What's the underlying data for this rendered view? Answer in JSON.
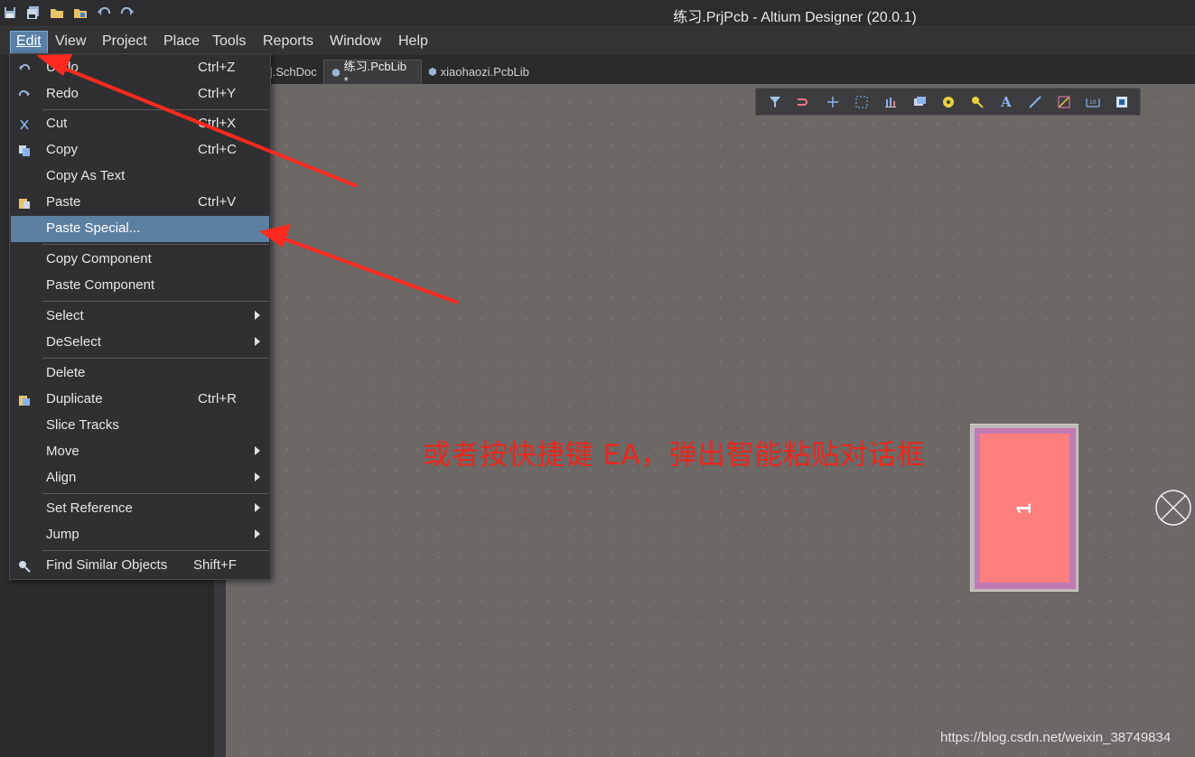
{
  "window": {
    "title": "练习.PrjPcb - Altium Designer (20.0.1)"
  },
  "quick_access": [
    "save-icon",
    "save-all-icon",
    "open-icon",
    "open-project-icon",
    "undo-icon",
    "redo-icon"
  ],
  "menubar": {
    "items": [
      {
        "label": "Edit",
        "active": true
      },
      {
        "label": "View"
      },
      {
        "label": "Project"
      },
      {
        "label": "Place"
      },
      {
        "label": "Tools"
      },
      {
        "label": "Reports"
      },
      {
        "label": "Window"
      },
      {
        "label": "Help"
      }
    ]
  },
  "tabs": [
    {
      "label": "].SchDoc"
    },
    {
      "label": "练习.PcbLib *",
      "active": true
    },
    {
      "label": "xiaohaozi.PcbLib"
    }
  ],
  "edit_menu": {
    "items": [
      {
        "label": "Undo",
        "shortcut": "Ctrl+Z",
        "icon": "undo-icon"
      },
      {
        "label": "Redo",
        "shortcut": "Ctrl+Y",
        "icon": "redo-icon"
      },
      {
        "label": "Cut",
        "shortcut": "Ctrl+X",
        "icon": "cut-icon"
      },
      {
        "label": "Copy",
        "shortcut": "Ctrl+C",
        "icon": "copy-icon"
      },
      {
        "label": "Copy As Text",
        "shortcut": ""
      },
      {
        "label": "Paste",
        "shortcut": "Ctrl+V",
        "icon": "paste-icon"
      },
      {
        "label": "Paste Special...",
        "shortcut": "",
        "highlighted": true
      },
      {
        "label": "Copy Component",
        "shortcut": ""
      },
      {
        "label": "Paste Component",
        "shortcut": ""
      },
      {
        "label": "Select",
        "submenu": true
      },
      {
        "label": "DeSelect",
        "submenu": true
      },
      {
        "label": "Delete",
        "shortcut": ""
      },
      {
        "label": "Duplicate",
        "shortcut": "Ctrl+R",
        "icon": "duplicate-icon"
      },
      {
        "label": "Slice Tracks",
        "shortcut": ""
      },
      {
        "label": "Move",
        "submenu": true
      },
      {
        "label": "Align",
        "submenu": true
      },
      {
        "label": "Set Reference",
        "submenu": true
      },
      {
        "label": "Jump",
        "submenu": true
      },
      {
        "label": "Find Similar Objects",
        "shortcut": "Shift+F",
        "icon": "find-similar-icon"
      }
    ]
  },
  "pcb_toolbar": [
    "filter-icon",
    "route-icon",
    "cross-icon",
    "select-rect-icon",
    "align-icon",
    "component-icon",
    "pad-icon",
    "via-icon",
    "text-icon",
    "line-icon",
    "arc-icon",
    "dimension-icon",
    "region-icon"
  ],
  "canvas": {
    "annotation": "或者按快捷键 EA，弹出智能粘贴对话框",
    "pad_label": "1",
    "watermark": "https://blog.csdn.net/weixin_38749834"
  },
  "colors": {
    "annotation": "#e8281e",
    "pad": "#ff7f7f",
    "highlight": "#5d7fa2"
  }
}
